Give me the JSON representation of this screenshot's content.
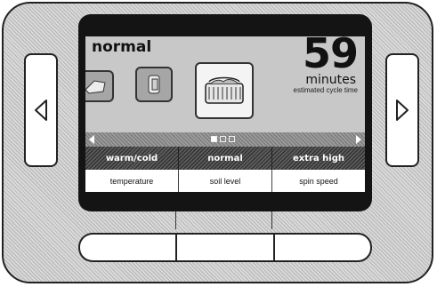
{
  "cycle": {
    "name": "normal",
    "time_value": "59",
    "time_unit": "minutes",
    "time_caption": "estimated cycle time"
  },
  "icons": {
    "tile_1": "cycle-icon",
    "tile_2": "cycle-icon",
    "selected": "basket-icon"
  },
  "pager": {
    "page_count": 3,
    "active_page": 1
  },
  "options": [
    {
      "value": "warm/cold",
      "label": "temperature"
    },
    {
      "value": "normal",
      "label": "soil level"
    },
    {
      "value": "extra high",
      "label": "spin speed"
    }
  ],
  "nav": {
    "left_icon": "left-triangle-icon",
    "right_icon": "right-triangle-icon"
  }
}
